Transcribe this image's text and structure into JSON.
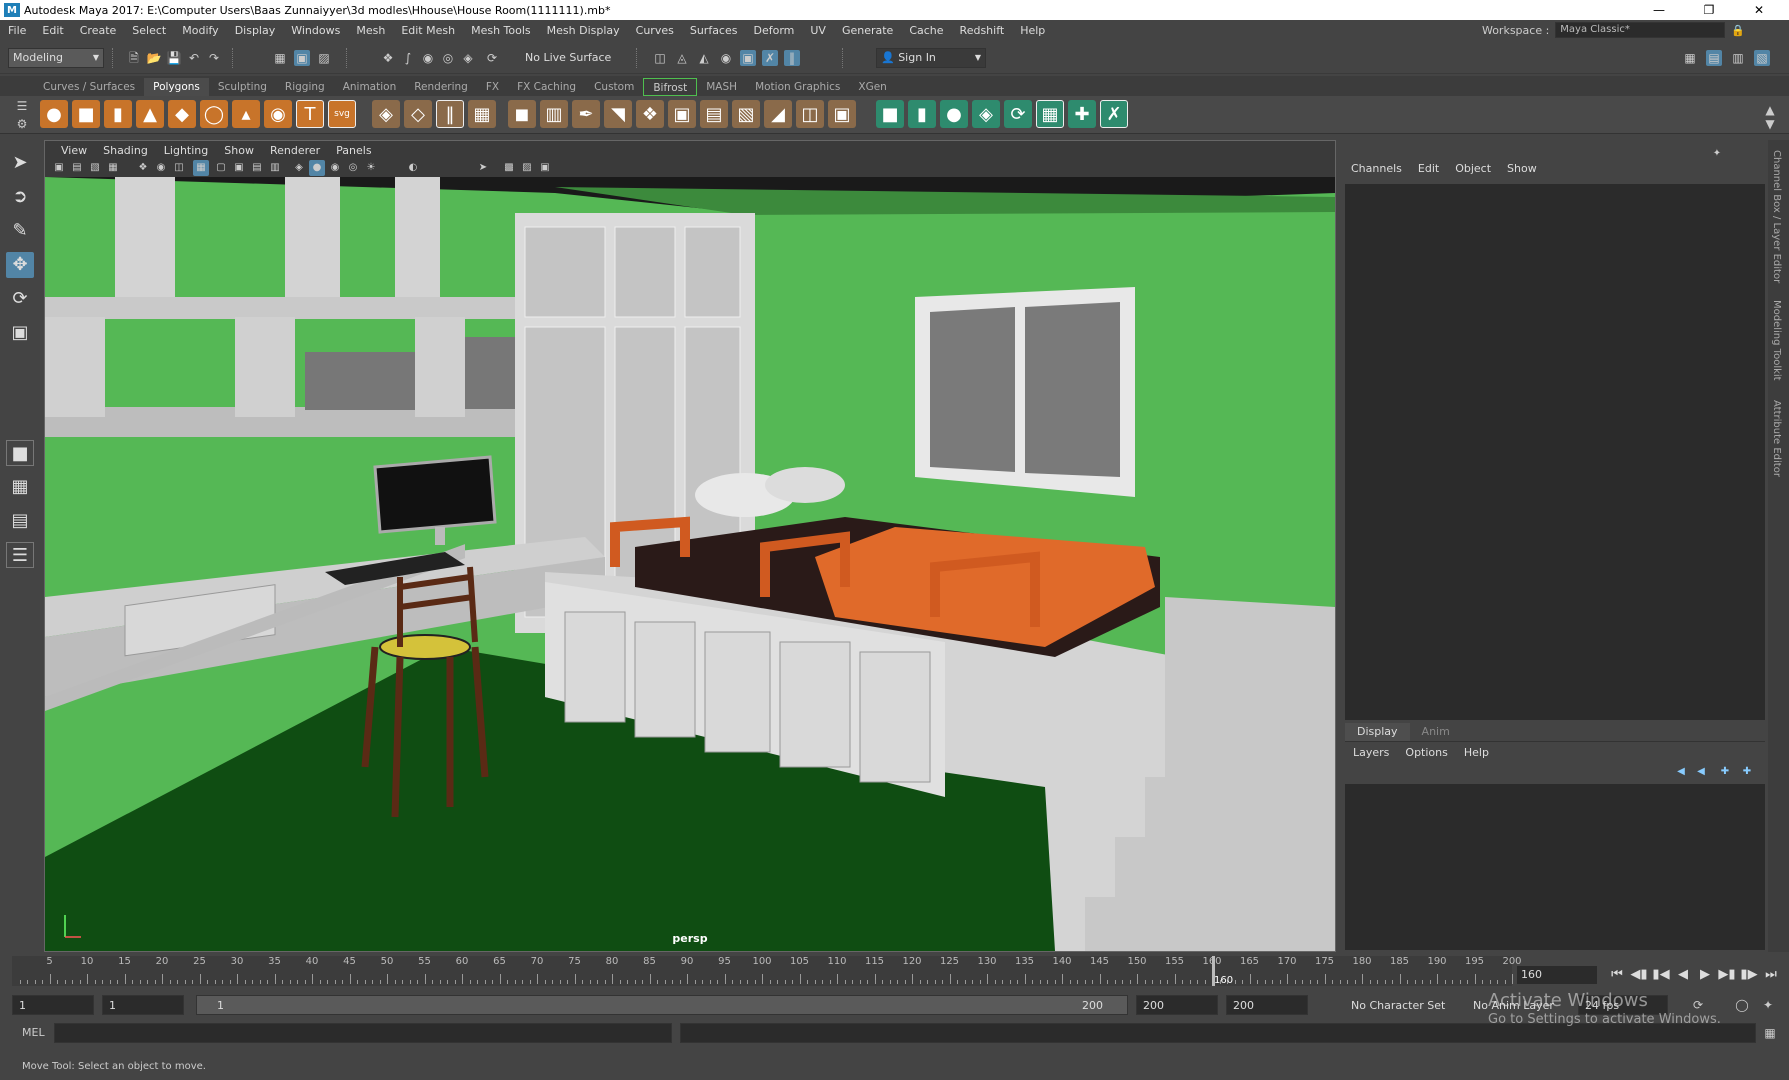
{
  "window": {
    "title": "Autodesk Maya 2017: E:\\Computer Users\\Baas Zunnaiyyer\\3d modles\\Hhouse\\House Room(1111111).mb*",
    "logo": "M"
  },
  "menubar": {
    "items": [
      "File",
      "Edit",
      "Create",
      "Select",
      "Modify",
      "Display",
      "Windows",
      "Mesh",
      "Edit Mesh",
      "Mesh Tools",
      "Mesh Display",
      "Curves",
      "Surfaces",
      "Deform",
      "UV",
      "Generate",
      "Cache",
      "Redshift",
      "Help"
    ],
    "workspace_label": "Workspace :",
    "workspace_value": "Maya Classic*"
  },
  "toolbar": {
    "mode": "Modeling",
    "live_surface": "No Live Surface",
    "sign_in": "Sign In"
  },
  "shelf": {
    "tabs": [
      "Curves / Surfaces",
      "Polygons",
      "Sculpting",
      "Rigging",
      "Animation",
      "Rendering",
      "FX",
      "FX Caching",
      "Custom",
      "Bifrost",
      "MASH",
      "Motion Graphics",
      "XGen"
    ],
    "active_tab": "Polygons"
  },
  "viewport": {
    "menu": [
      "View",
      "Shading",
      "Lighting",
      "Show",
      "Renderer",
      "Panels"
    ],
    "camera_label": "persp"
  },
  "channel_box": {
    "menu": [
      "Channels",
      "Edit",
      "Object",
      "Show"
    ]
  },
  "layer_editor": {
    "tabs": [
      "Display",
      "Anim"
    ],
    "menu": [
      "Layers",
      "Options",
      "Help"
    ]
  },
  "side_tabs": [
    "Channel Box / Layer Editor",
    "Modeling Toolkit",
    "Attribute Editor"
  ],
  "timeline": {
    "ticks": [
      "5",
      "10",
      "15",
      "20",
      "25",
      "30",
      "35",
      "40",
      "45",
      "50",
      "55",
      "60",
      "65",
      "70",
      "75",
      "80",
      "85",
      "90",
      "95",
      "100",
      "105",
      "110",
      "115",
      "120",
      "125",
      "130",
      "135",
      "140",
      "145",
      "150",
      "155",
      "160",
      "165",
      "170",
      "175",
      "180",
      "185",
      "190",
      "195",
      "200"
    ],
    "current_marker": "160",
    "current_frame": "160"
  },
  "range": {
    "start": "1",
    "start2": "1",
    "slider_start": "1",
    "slider_end": "200",
    "end": "200",
    "end2": "200",
    "character_set": "No Character Set",
    "anim_layer": "No Anim Layer",
    "fps": "24 fps"
  },
  "mel": {
    "label": "MEL"
  },
  "status": {
    "text": "Move Tool: Select an object to move."
  },
  "watermark": {
    "line1": "Activate Windows",
    "line2": "Go to Settings to activate Windows."
  }
}
